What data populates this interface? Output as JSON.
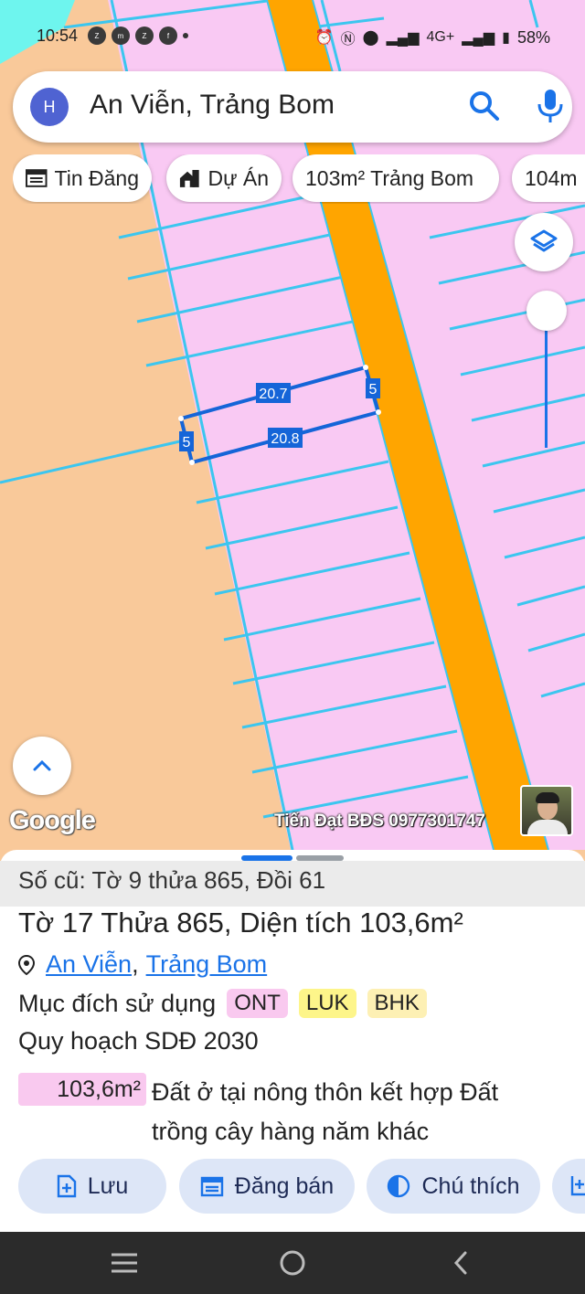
{
  "status_bar": {
    "time": "10:54",
    "app_icons": [
      "zalo-icon",
      "messenger-icon",
      "zalo-icon",
      "facebook-icon",
      "dot-icon"
    ],
    "network": "4G+",
    "battery": "58%"
  },
  "search": {
    "avatar_initial": "H",
    "query": "An Viễn, Trảng Bom"
  },
  "chips": [
    {
      "label": "Tin Đăng",
      "icon": "listing-icon"
    },
    {
      "label": "Dự Án",
      "icon": "buildings-icon"
    },
    {
      "label": "103m² Trảng Bom",
      "icon": ""
    },
    {
      "label": "104m",
      "icon": ""
    }
  ],
  "map": {
    "colors": {
      "land": "#f9c99a",
      "residential": "#f9c9f3",
      "road": "#ffa500",
      "boundary": "#3cc6ef",
      "selection": "#1565d8",
      "water": "#6ef5ee"
    },
    "edge_labels": {
      "top": "20.7",
      "bottom": "20.8",
      "left": "5",
      "right": "5"
    },
    "attribution": "Google",
    "watermark": "Tiến Đạt BĐS 0977301747"
  },
  "parcel": {
    "old_ref": "Số cũ: Tờ 9 thửa 865, Đồi 61",
    "title": "Tờ 17 Thửa 865, Diện tích 103,6m²",
    "location": {
      "commune": "An Viễn",
      "district": "Trảng Bom",
      "separator": ","
    },
    "purpose_label": "Mục đích sử dụng",
    "tags": [
      {
        "code": "ONT",
        "color": "#f9c9ef"
      },
      {
        "code": "LUK",
        "color": "#fdf58a"
      },
      {
        "code": "BHK",
        "color": "#fdf0b4"
      }
    ],
    "plan_label": "Quy hoạch SDĐ 2030",
    "plan_area": "103,6m²",
    "plan_desc": "Đất ở tại nông thôn kết hợp Đất trồng cây hàng năm khác"
  },
  "actions": [
    {
      "label": "Lưu",
      "icon": "save-add-icon"
    },
    {
      "label": "Đăng bán",
      "icon": "calendar-icon"
    },
    {
      "label": "Chú thích",
      "icon": "contrast-icon"
    }
  ]
}
